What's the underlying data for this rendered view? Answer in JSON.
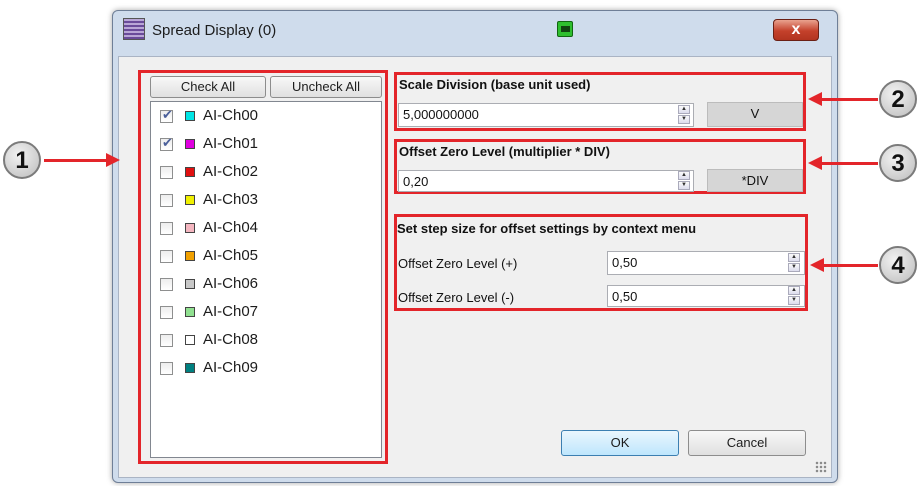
{
  "window": {
    "title": "Spread Display (0)",
    "close_label": "x",
    "print_icon": "printer-icon"
  },
  "left_panel": {
    "check_all": "Check All",
    "uncheck_all": "Uncheck All",
    "channels": [
      {
        "label": "AI-Ch00",
        "checked": true,
        "color": "#00e5e5"
      },
      {
        "label": "AI-Ch01",
        "checked": true,
        "color": "#e000e0"
      },
      {
        "label": "AI-Ch02",
        "checked": false,
        "color": "#e01010"
      },
      {
        "label": "AI-Ch03",
        "checked": false,
        "color": "#f0f000"
      },
      {
        "label": "AI-Ch04",
        "checked": false,
        "color": "#f4b6c0"
      },
      {
        "label": "AI-Ch05",
        "checked": false,
        "color": "#f0a000"
      },
      {
        "label": "AI-Ch06",
        "checked": false,
        "color": "#c8c8c8"
      },
      {
        "label": "AI-Ch07",
        "checked": false,
        "color": "#90e090"
      },
      {
        "label": "AI-Ch08",
        "checked": false,
        "color": "#ffffff"
      },
      {
        "label": "AI-Ch09",
        "checked": false,
        "color": "#008080"
      }
    ]
  },
  "scale_division": {
    "title": "Scale Division (base unit used)",
    "value": "5,000000000",
    "unit": "V"
  },
  "offset_zero": {
    "title": "Offset Zero Level (multiplier * DIV)",
    "value": "0,20",
    "unit": "*DIV"
  },
  "step_size": {
    "title": "Set step size for offset settings by context menu",
    "plus_label": "Offset Zero Level (+)",
    "plus_value": "0,50",
    "minus_label": "Offset Zero Level (-)",
    "minus_value": "0,50"
  },
  "buttons": {
    "ok": "OK",
    "cancel": "Cancel"
  },
  "callouts": [
    "1",
    "2",
    "3",
    "4"
  ],
  "colors": {
    "annotation_red": "#e3252a"
  }
}
